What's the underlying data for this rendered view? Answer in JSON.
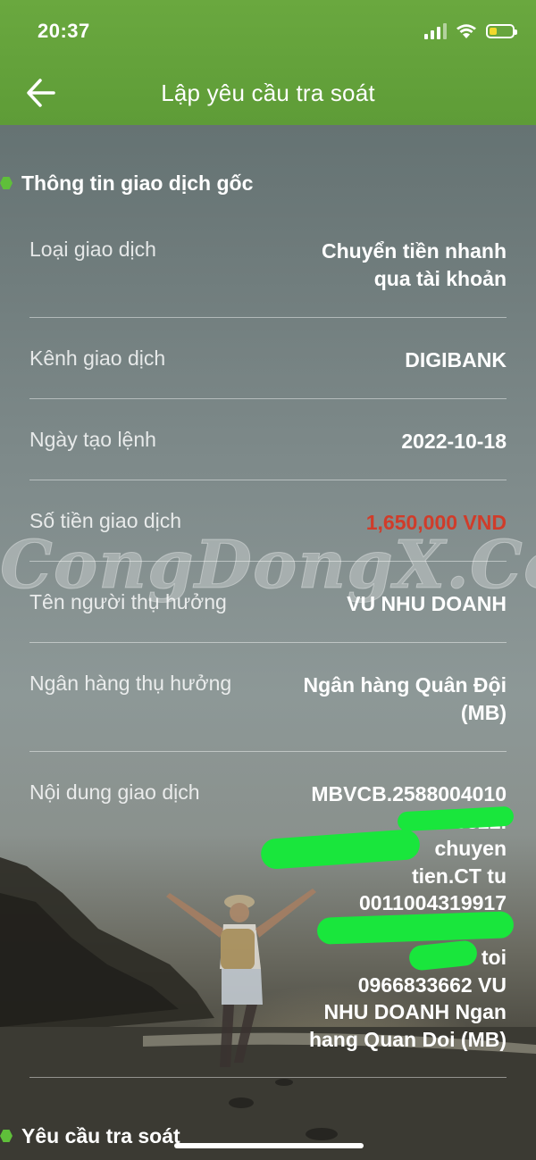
{
  "status_bar": {
    "time": "20:37"
  },
  "header": {
    "title": "Lập yêu cầu tra soát"
  },
  "watermark": "CongDongX.Com",
  "sections": {
    "original": {
      "title": "Thông tin giao dịch gốc"
    },
    "request": {
      "title": "Yêu cầu tra soát"
    }
  },
  "details": [
    {
      "label": "Loại giao dịch",
      "value": "Chuyển tiền nhanh\nqua tài khoản"
    },
    {
      "label": "Kênh giao dịch",
      "value": "DIGIBANK"
    },
    {
      "label": "Ngày tạo lệnh",
      "value": "2022-10-18"
    },
    {
      "label": "Số tiền giao dịch",
      "value": "1,650,000 VND"
    },
    {
      "label": "Tên người thụ hưởng",
      "value": "VU NHU DOANH"
    },
    {
      "label": "Ngân hàng thụ hưởng",
      "value": "Ngân hàng Quân Đội\n(MB)"
    },
    {
      "label": "Nội dung giao dịch",
      "value": "MBVCB.2588004010\n.046322.\nchuyen\ntien.CT tu\n0011004319917\n\ntoi\n0966833662 VU\nNHU DOANH Ngan\nhang Quan Doi (MB)"
    }
  ],
  "colors": {
    "header_green": "#5e9c37",
    "bullet_green": "#5fbf3a",
    "amount_red": "#d03c2a",
    "redaction_green": "#19e63c"
  },
  "icons": [
    "back-arrow-icon",
    "cellular-signal-icon",
    "wifi-icon",
    "battery-icon"
  ]
}
